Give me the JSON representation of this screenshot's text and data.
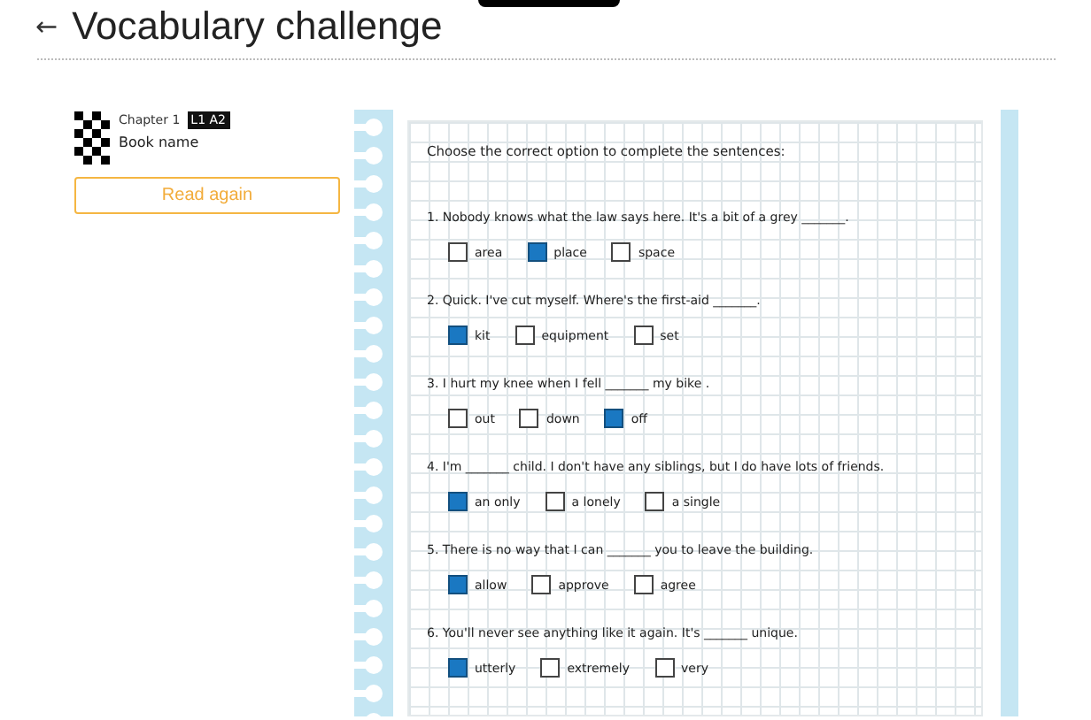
{
  "header": {
    "back": "←",
    "title": "Vocabulary challenge"
  },
  "book": {
    "chapter": "Chapter 1",
    "level": "L1 A2",
    "name": "Book name",
    "button": "Read again"
  },
  "exercise": {
    "instruction": "Choose the correct option to complete the sentences:",
    "questions": [
      {
        "text": "1. Nobody knows what the law says here. It's a bit of a grey _______.",
        "options": [
          {
            "label": "area",
            "checked": false
          },
          {
            "label": "place",
            "checked": true
          },
          {
            "label": "space",
            "checked": false
          }
        ]
      },
      {
        "text": "2. Quick. I've cut myself. Where's the first-aid _______.",
        "options": [
          {
            "label": "kit",
            "checked": true
          },
          {
            "label": "equipment",
            "checked": false
          },
          {
            "label": "set",
            "checked": false
          }
        ]
      },
      {
        "text": "3. I hurt my knee when I fell _______ my bike .",
        "options": [
          {
            "label": "out",
            "checked": false
          },
          {
            "label": "down",
            "checked": false
          },
          {
            "label": "off",
            "checked": true
          }
        ]
      },
      {
        "text": "4. I'm _______ child. I don't have any siblings, but I do have lots of friends.",
        "options": [
          {
            "label": "an only",
            "checked": true
          },
          {
            "label": "a lonely",
            "checked": false
          },
          {
            "label": "a single",
            "checked": false
          }
        ]
      },
      {
        "text": "5. There is no way that I can _______ you to leave the building.",
        "options": [
          {
            "label": "allow",
            "checked": true
          },
          {
            "label": "approve",
            "checked": false
          },
          {
            "label": "agree",
            "checked": false
          }
        ]
      },
      {
        "text": "6. You'll never see anything like it again. It's _______ unique.",
        "options": [
          {
            "label": "utterly",
            "checked": true
          },
          {
            "label": "extremely",
            "checked": false
          },
          {
            "label": "very",
            "checked": false
          }
        ]
      }
    ]
  }
}
